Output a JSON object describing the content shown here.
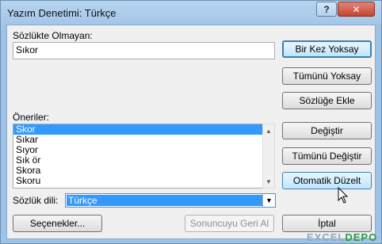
{
  "window": {
    "title": "Yazım Denetimi: Türkçe",
    "help_glyph": "?",
    "close_glyph": "✕"
  },
  "not_in_dictionary": {
    "label": "Sözlükte Olmayan:",
    "value": "Sıkor"
  },
  "suggestions": {
    "label": "Öneriler:",
    "items": [
      "Skor",
      "Sıkar",
      "Sıyor",
      "Sık ör",
      "Skora",
      "Skoru"
    ],
    "selected_index": 0
  },
  "dictionary_language": {
    "label": "Sözlük dili:",
    "value": "Türkçe"
  },
  "buttons": {
    "ignore_once": "Bir Kez Yoksay",
    "ignore_all": "Tümünü Yoksay",
    "add_to_dictionary": "Sözlüğe Ekle",
    "change": "Değiştir",
    "change_all": "Tümünü Değiştir",
    "autocorrect": "Otomatik Düzelt",
    "options": "Seçenekler...",
    "undo_last": "Sonuncuyu Geri Al",
    "cancel": "İptal"
  },
  "watermark": {
    "prefix": "EXCEL",
    "suffix": "DEPO"
  },
  "colors": {
    "selection": "#3399ff",
    "title_bar": "#a3c6e8",
    "close_button": "#c6442e"
  }
}
